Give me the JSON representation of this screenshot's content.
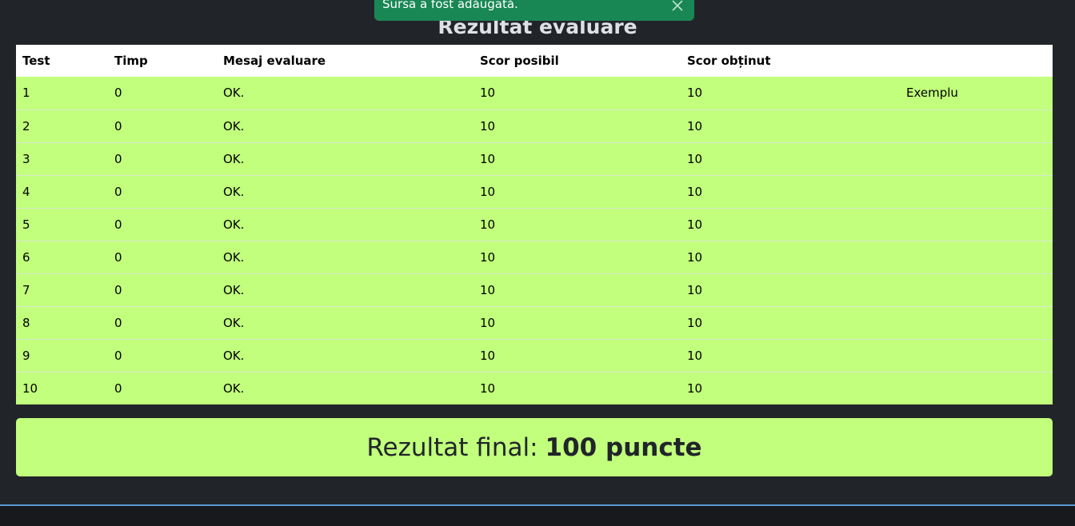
{
  "toast": {
    "message": "Sursa a fost adăugată."
  },
  "page": {
    "title": "Rezultat evaluare"
  },
  "table": {
    "headers": {
      "test": "Test",
      "time": "Timp",
      "message": "Mesaj evaluare",
      "possible": "Scor posibil",
      "obtained": "Scor obținut",
      "extra": ""
    },
    "rows": [
      {
        "test": "1",
        "time": "0",
        "message": "OK.",
        "possible": "10",
        "obtained": "10",
        "extra": "Exemplu"
      },
      {
        "test": "2",
        "time": "0",
        "message": "OK.",
        "possible": "10",
        "obtained": "10",
        "extra": ""
      },
      {
        "test": "3",
        "time": "0",
        "message": "OK.",
        "possible": "10",
        "obtained": "10",
        "extra": ""
      },
      {
        "test": "4",
        "time": "0",
        "message": "OK.",
        "possible": "10",
        "obtained": "10",
        "extra": ""
      },
      {
        "test": "5",
        "time": "0",
        "message": "OK.",
        "possible": "10",
        "obtained": "10",
        "extra": ""
      },
      {
        "test": "6",
        "time": "0",
        "message": "OK.",
        "possible": "10",
        "obtained": "10",
        "extra": ""
      },
      {
        "test": "7",
        "time": "0",
        "message": "OK.",
        "possible": "10",
        "obtained": "10",
        "extra": ""
      },
      {
        "test": "8",
        "time": "0",
        "message": "OK.",
        "possible": "10",
        "obtained": "10",
        "extra": ""
      },
      {
        "test": "9",
        "time": "0",
        "message": "OK.",
        "possible": "10",
        "obtained": "10",
        "extra": ""
      },
      {
        "test": "10",
        "time": "0",
        "message": "OK.",
        "possible": "10",
        "obtained": "10",
        "extra": ""
      }
    ]
  },
  "final": {
    "label": "Rezultat final:",
    "score": "100 puncte"
  },
  "colors": {
    "background": "#212529",
    "success_row": "#c1ff7c",
    "toast": "#198754",
    "footer_accent": "#5a9bd5"
  },
  "icons": {
    "toast_close": "close-icon"
  }
}
